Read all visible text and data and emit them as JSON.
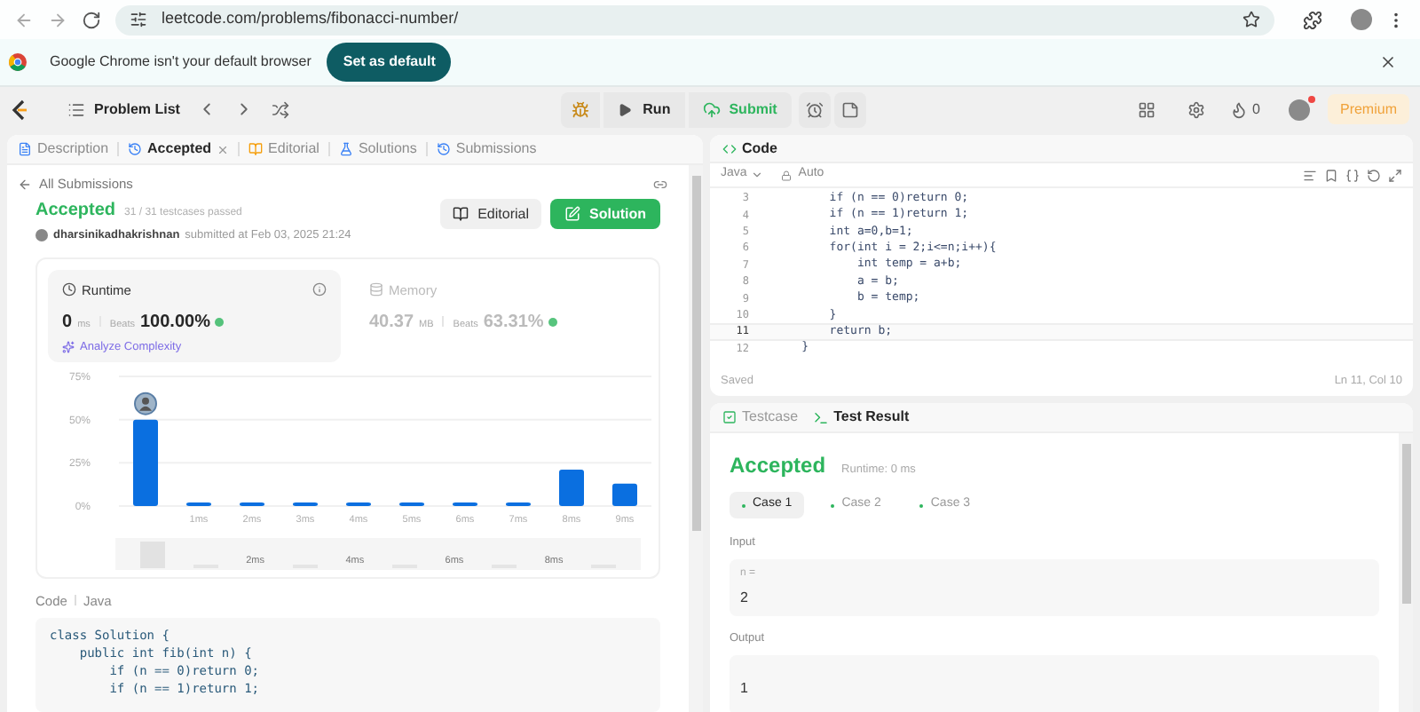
{
  "browser": {
    "url": "leetcode.com/problems/fibonacci-number/"
  },
  "infobar": {
    "message": "Google Chrome isn't your default browser",
    "button": "Set as default"
  },
  "nav": {
    "problem_list": "Problem List",
    "run": "Run",
    "submit": "Submit",
    "streak": "0",
    "premium": "Premium"
  },
  "left_tabs": [
    {
      "kind": "description",
      "label": "Description",
      "selected": false,
      "closable": false
    },
    {
      "kind": "accepted",
      "label": "Accepted",
      "selected": true,
      "closable": true
    },
    {
      "kind": "editorial",
      "label": "Editorial",
      "selected": false,
      "closable": false
    },
    {
      "kind": "solutions",
      "label": "Solutions",
      "selected": false,
      "closable": false
    },
    {
      "kind": "submissions",
      "label": "Submissions",
      "selected": false,
      "closable": false
    }
  ],
  "submission": {
    "back": "All Submissions",
    "status": "Accepted",
    "passed": "31 / 31 testcases passed",
    "user": "dharsinikadhakrishnan",
    "submitted": "submitted at Feb 03, 2025 21:24",
    "editorial_button": "Editorial",
    "solution_button": "Solution"
  },
  "stats": [
    {
      "kind": "runtime",
      "title": "Runtime",
      "value": "0",
      "unit": "ms",
      "beats_label": "Beats",
      "beats": "100.00%",
      "selected": true
    },
    {
      "kind": "memory",
      "title": "Memory",
      "value": "40.37",
      "unit": "MB",
      "beats_label": "Beats",
      "beats": "63.31%",
      "selected": false
    }
  ],
  "analyze": "Analyze Complexity",
  "chart_data": {
    "type": "bar",
    "x": [
      0,
      1,
      2,
      3,
      4,
      5,
      6,
      7,
      8,
      9
    ],
    "series": [
      {
        "color": "#0a6fe0",
        "values": [
          50,
          2,
          2,
          2,
          2,
          2,
          2,
          2,
          21,
          13
        ]
      }
    ],
    "xlim": [
      -0.5,
      9.5
    ],
    "ylim": [
      0,
      75
    ],
    "yticks": [
      {
        "value": 0,
        "label": "0%"
      },
      {
        "value": 25,
        "label": "25%"
      },
      {
        "value": 50,
        "label": "50%"
      },
      {
        "value": 75,
        "label": "75%"
      }
    ],
    "xticks": [
      {
        "value": 1,
        "label": "1ms"
      },
      {
        "value": 2,
        "label": "2ms"
      },
      {
        "value": 3,
        "label": "3ms"
      },
      {
        "value": 4,
        "label": "4ms"
      },
      {
        "value": 5,
        "label": "5ms"
      },
      {
        "value": 6,
        "label": "6ms"
      },
      {
        "value": 7,
        "label": "7ms"
      },
      {
        "value": 8,
        "label": "8ms"
      },
      {
        "value": 9,
        "label": "9ms"
      }
    ]
  },
  "brush_labels": [
    "2ms",
    "4ms",
    "6ms",
    "8ms"
  ],
  "code_section": {
    "label": "Code",
    "language": "Java",
    "lines": [
      "class Solution {",
      "    public int fib(int n) {",
      "        if (n == 0)return 0;",
      "        if (n == 1)return 1;"
    ]
  },
  "editor": {
    "title": "Code",
    "language": "Java",
    "mode": "Auto",
    "status": "Saved",
    "cursor": "Ln 11, Col 10",
    "lines": [
      {
        "number": "3",
        "text": "        if (n == 0)return 0;",
        "current": false
      },
      {
        "number": "4",
        "text": "        if (n == 1)return 1;",
        "current": false
      },
      {
        "number": "5",
        "text": "        int a=0,b=1;",
        "current": false
      },
      {
        "number": "6",
        "text": "        for(int i = 2;i<=n;i++){",
        "current": false
      },
      {
        "number": "7",
        "text": "            int temp = a+b;",
        "current": false
      },
      {
        "number": "8",
        "text": "            a = b;",
        "current": false
      },
      {
        "number": "9",
        "text": "            b = temp;",
        "current": false
      },
      {
        "number": "10",
        "text": "        }",
        "current": false
      },
      {
        "number": "11",
        "text": "        return b;",
        "current": true
      },
      {
        "number": "12",
        "text": "    }",
        "current": false
      }
    ]
  },
  "test_tabs": [
    {
      "kind": "testcase",
      "label": "Testcase",
      "selected": false
    },
    {
      "kind": "result",
      "label": "Test Result",
      "selected": true
    }
  ],
  "result": {
    "status": "Accepted",
    "runtime": "Runtime: 0 ms",
    "cases": [
      {
        "label": "Case 1",
        "selected": true
      },
      {
        "label": "Case 2",
        "selected": false
      },
      {
        "label": "Case 3",
        "selected": false
      }
    ],
    "input_label": "Input",
    "input_name": "n =",
    "input_value": "2",
    "output_label": "Output",
    "output_value": "1"
  }
}
